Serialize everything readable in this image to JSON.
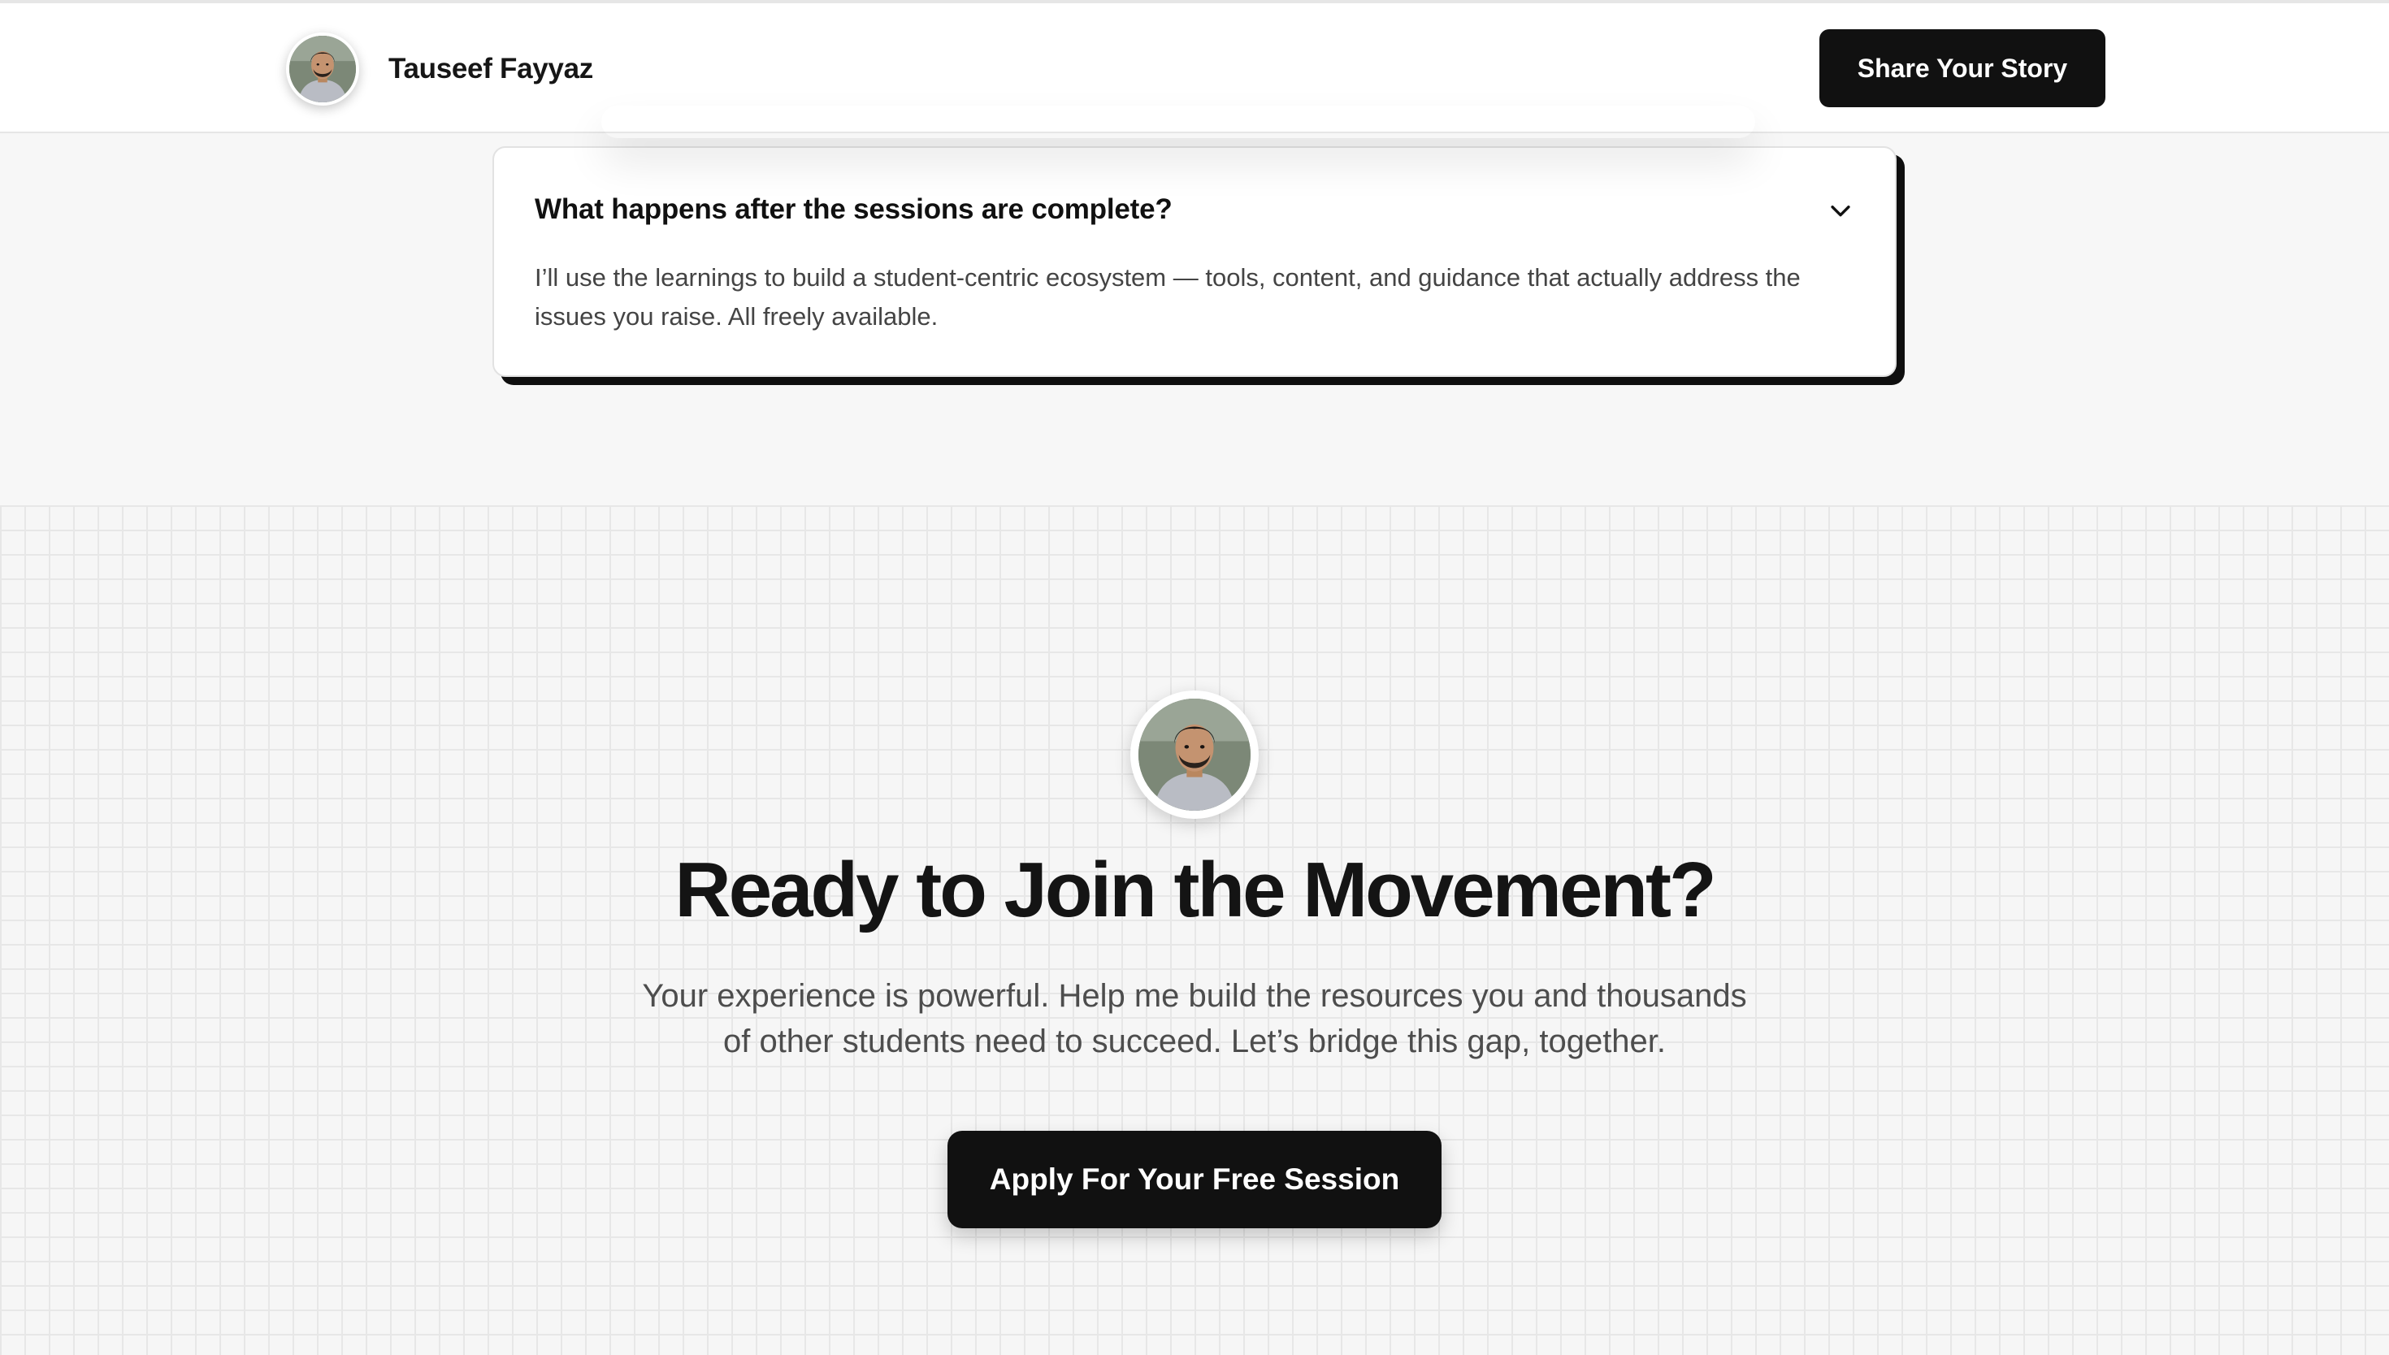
{
  "header": {
    "brand_name": "Tauseef Fayyaz",
    "avatar_icon": "person-portrait-icon",
    "share_button_label": "Share Your Story"
  },
  "faq": {
    "question": "What happens after the sessions are complete?",
    "answer": "I’ll use the learnings to build a student-centric ecosystem — tools, content, and guidance that actually address the issues you raise. All freely available.",
    "toggle_icon": "chevron-down-icon",
    "expanded": true
  },
  "cta": {
    "avatar_icon": "person-portrait-icon",
    "title": "Ready to Join the Movement?",
    "description": "Your experience is powerful. Help me build the resources you and thousands of other students need to succeed. Let’s bridge this gap, together.",
    "button_label": "Apply For Your Free Session"
  },
  "colors": {
    "primary_button_bg": "#111111",
    "primary_button_text": "#ffffff",
    "page_bg": "#f7f7f7",
    "card_shadow": "#0f0f0f",
    "grid_line": "#e7e7e7"
  }
}
